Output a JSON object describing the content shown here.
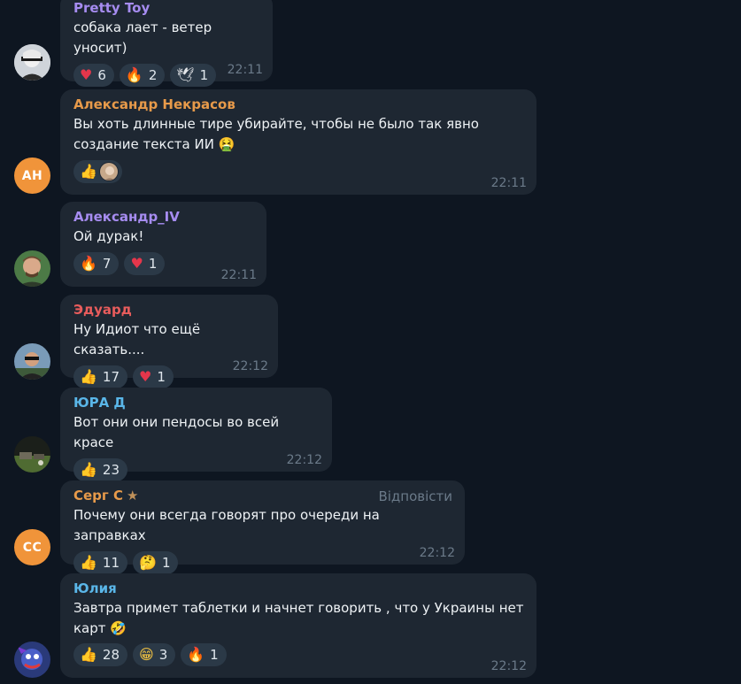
{
  "messages": [
    {
      "sender": "Pretty Toy",
      "sender_color": "#a68cf0",
      "text": "собака лает - ветер уносит)",
      "time": "22:11",
      "reactions": [
        {
          "icon": "heart-icon",
          "glyph": "♥",
          "count": "6"
        },
        {
          "icon": "fire-icon",
          "glyph": "🔥",
          "count": "2"
        },
        {
          "icon": "dove-icon",
          "glyph": "🕊",
          "count": "1"
        }
      ]
    },
    {
      "sender": "Александр Некрасов",
      "sender_color": "#e79a4a",
      "initials": "АН",
      "text": "Вы хоть длинные тире убирайте, чтобы не было так явно\nсоздание текста ИИ 🤮",
      "time": "22:11",
      "reactions": [
        {
          "icon": "thumbs-up-icon",
          "glyph": "👍",
          "count": ""
        }
      ]
    },
    {
      "sender": "Александр_IV",
      "sender_color": "#a68cf0",
      "text": "Ой дурак!",
      "time": "22:11",
      "reactions": [
        {
          "icon": "fire-icon",
          "glyph": "🔥",
          "count": "7"
        },
        {
          "icon": "heart-icon",
          "glyph": "♥",
          "count": "1"
        }
      ]
    },
    {
      "sender": "Эдуард",
      "sender_color": "#e85c5c",
      "text": "Ну Идиот что ещё сказать....",
      "time": "22:12",
      "reactions": [
        {
          "icon": "thumbs-up-icon",
          "glyph": "👍",
          "count": "17"
        },
        {
          "icon": "heart-icon",
          "glyph": "♥",
          "count": "1"
        }
      ]
    },
    {
      "sender": "ЮРА Д",
      "sender_color": "#5ab6e8",
      "text": "Вот они они пендосы во всей красе",
      "time": "22:12",
      "reactions": [
        {
          "icon": "thumbs-up-icon",
          "glyph": "👍",
          "count": "23"
        }
      ]
    },
    {
      "sender": "Серг С",
      "sender_color": "#e79a4a",
      "initials": "CC",
      "reply_label": "Відповісти",
      "text": "Почему они всегда говорят про очереди на заправках",
      "time": "22:12",
      "reactions": [
        {
          "icon": "thumbs-up-icon",
          "glyph": "👍",
          "count": "11"
        },
        {
          "icon": "thinking-face-icon",
          "glyph": "🤔",
          "count": "1"
        }
      ]
    },
    {
      "sender": "Юлия",
      "sender_color": "#5ab6e8",
      "text": "Завтра примет таблетки и начнет говорить , что у Украины нет\nкарт 🤣",
      "time": "22:12",
      "reactions": [
        {
          "icon": "thumbs-up-icon",
          "glyph": "👍",
          "count": "28"
        },
        {
          "icon": "grinning-face-icon",
          "glyph": "😁",
          "count": "3"
        },
        {
          "icon": "fire-icon",
          "glyph": "🔥",
          "count": "1"
        }
      ]
    }
  ]
}
